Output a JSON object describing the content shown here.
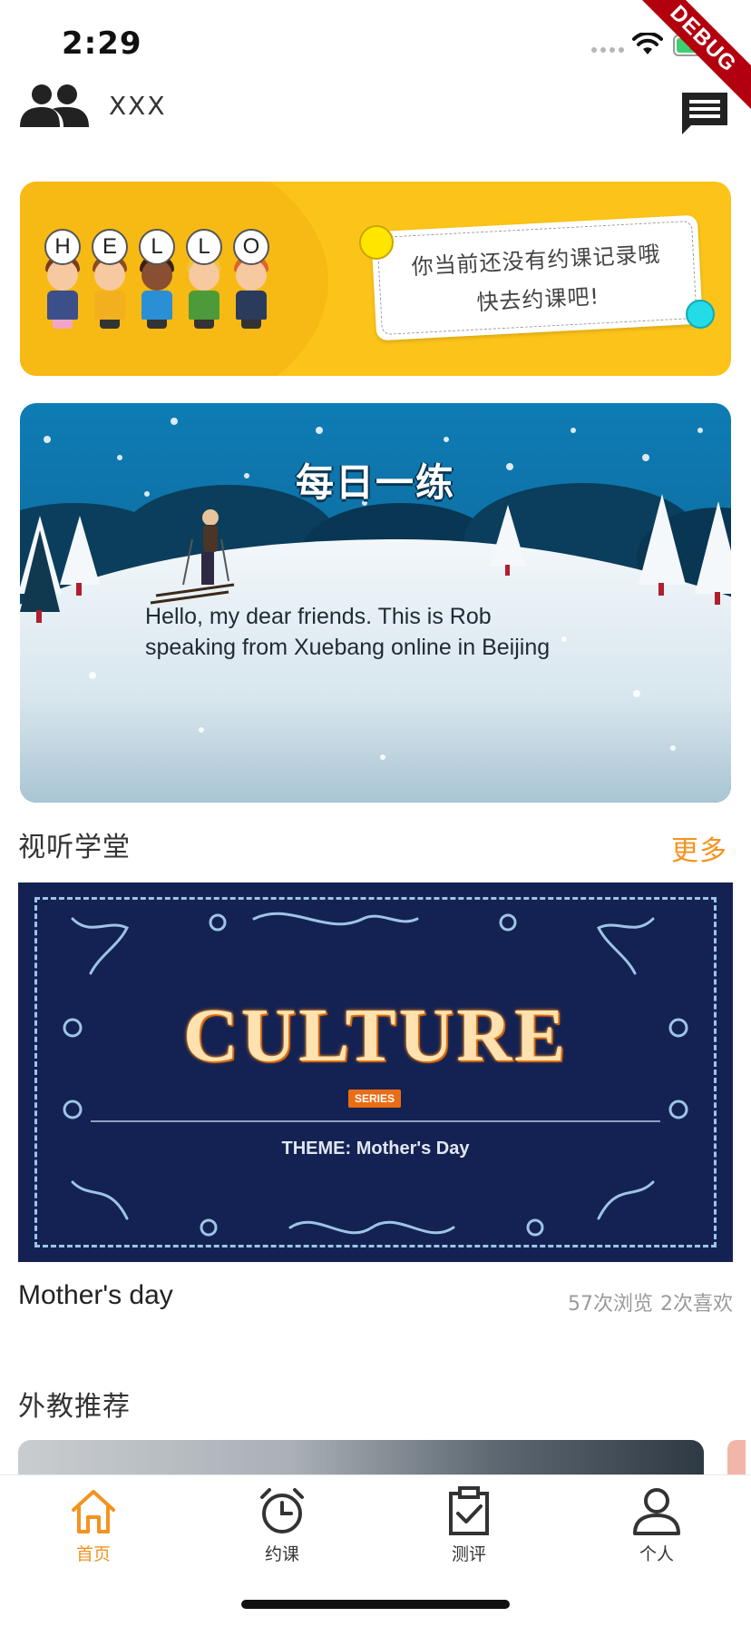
{
  "status_bar": {
    "time": "2:29"
  },
  "debug_banner": "DEBUG",
  "header": {
    "user_name": "XXX"
  },
  "hello_banner": {
    "letters": [
      "H",
      "E",
      "L",
      "L",
      "O"
    ],
    "notice_line1": "你当前还没有约课记录哦",
    "notice_line2": "快去约课吧!"
  },
  "daily_practice": {
    "title": "每日一练",
    "text": "Hello, my dear friends. This is Rob speaking from Xuebang online in Beijing"
  },
  "audio_video_section": {
    "title": "视听学堂",
    "more_label": "更多",
    "video": {
      "cover_title": "CULTURE",
      "cover_badge": "SERIES",
      "cover_theme": "THEME:  Mother's Day",
      "name": "Mother's day",
      "views": "57次浏览",
      "likes": "2次喜欢"
    }
  },
  "teacher_section": {
    "title": "外教推荐"
  },
  "tab_bar": {
    "tabs": [
      {
        "label": "首页",
        "icon": "home-icon",
        "active": true
      },
      {
        "label": "约课",
        "icon": "alarm-clock-icon",
        "active": false
      },
      {
        "label": "测评",
        "icon": "clipboard-check-icon",
        "active": false
      },
      {
        "label": "个人",
        "icon": "person-icon",
        "active": false
      }
    ]
  },
  "colors": {
    "accent": "#f5921e",
    "banner_yellow": "#fcc419",
    "cover_navy": "#142253"
  }
}
